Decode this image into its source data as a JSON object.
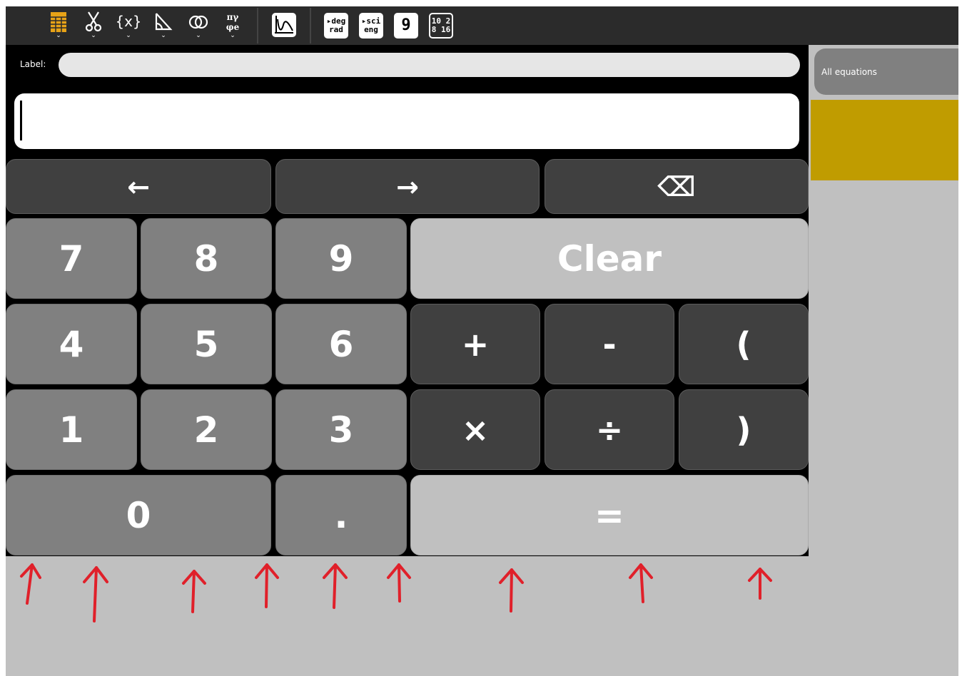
{
  "toolbar": {
    "tools": [
      {
        "name": "keypad-menu-icon"
      },
      {
        "name": "scissors-menu-icon"
      },
      {
        "name": "variables-menu-icon"
      },
      {
        "name": "geometry-menu-icon"
      },
      {
        "name": "sets-menu-icon"
      },
      {
        "name": "constants-menu-icon"
      }
    ],
    "mode_keys": {
      "deg": "▸deg",
      "rad": "rad",
      "sci": "▸sci",
      "eng": "eng",
      "digits": "9",
      "base_top": "10 2",
      "base_bottom": "8 16"
    }
  },
  "label_field": {
    "label": "Label:",
    "value": ""
  },
  "expression_field": {
    "value": ""
  },
  "keypad": {
    "left": "←",
    "right": "→",
    "backspace": "⌫",
    "seven": "7",
    "eight": "8",
    "nine": "9",
    "clear": "Clear",
    "four": "4",
    "five": "5",
    "six": "6",
    "plus": "+",
    "minus": "-",
    "lparen": "(",
    "one": "1",
    "two": "2",
    "three": "3",
    "times": "×",
    "divide": "÷",
    "rparen": ")",
    "zero": "0",
    "dot": ".",
    "equals": "="
  },
  "sidebar": {
    "all_equations": "All equations"
  },
  "colors": {
    "toolbar_bg": "#2b2b2b",
    "panel_bg": "#000000",
    "key_dark": "#404040",
    "key_gray": "#808080",
    "key_light": "#c0c0c0",
    "selected_equation": "#c09c00",
    "annotation_arrows": "#e0202a"
  }
}
